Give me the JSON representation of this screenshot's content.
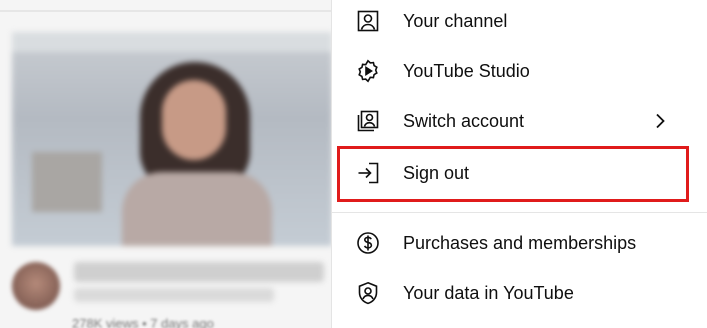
{
  "menu": {
    "items": [
      {
        "label": "Your channel",
        "icon": "user-square-icon"
      },
      {
        "label": "YouTube Studio",
        "icon": "studio-gear-icon"
      },
      {
        "label": "Switch account",
        "icon": "switch-account-icon",
        "has_submenu": true
      },
      {
        "label": "Sign out",
        "icon": "sign-out-icon"
      },
      {
        "label": "Purchases and memberships",
        "icon": "dollar-circle-icon"
      },
      {
        "label": "Your data in YouTube",
        "icon": "shield-user-icon"
      }
    ]
  },
  "background": {
    "video_meta": "278K views • 7 days ago"
  },
  "colors": {
    "highlight": "#e01b1b",
    "text": "#0f0f0f",
    "icon": "#0f0f0f"
  }
}
